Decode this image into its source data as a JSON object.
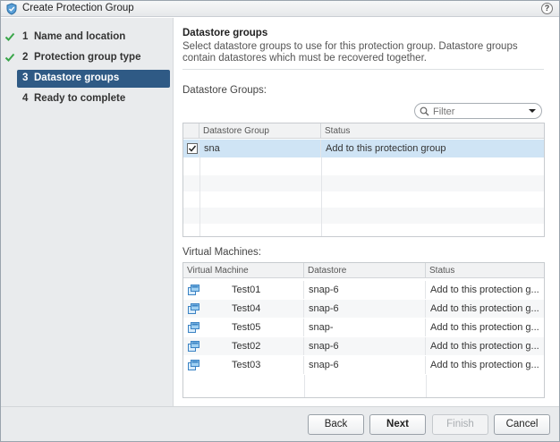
{
  "window": {
    "title": "Create Protection Group",
    "help_label": "?"
  },
  "nav": {
    "items": [
      {
        "number": "1",
        "label": "Name and location",
        "done": true
      },
      {
        "number": "2",
        "label": "Protection group type",
        "done": true
      },
      {
        "number": "3",
        "label": "Datastore groups",
        "active": true
      },
      {
        "number": "4",
        "label": "Ready to complete"
      }
    ]
  },
  "section": {
    "title": "Datastore groups",
    "description": "Select datastore groups to use for this protection group. Datastore groups contain datastores which must be recovered together.",
    "datastore_groups_label": "Datastore Groups:",
    "virtual_machines_label": "Virtual Machines:"
  },
  "filter": {
    "placeholder": "Filter"
  },
  "datastore_grid": {
    "columns": [
      "Datastore Group",
      "Status"
    ],
    "rows": [
      {
        "name": "sna",
        "status": "Add to this protection group",
        "checked": true
      }
    ]
  },
  "vm_grid": {
    "columns": [
      "Virtual Machine",
      "Datastore",
      "Status"
    ],
    "rows": [
      {
        "vm": "Test01",
        "datastore": "snap-6",
        "status": "Add to this protection g..."
      },
      {
        "vm": "Test04",
        "datastore": "snap-6",
        "status": "Add to this protection g..."
      },
      {
        "vm": "Test05",
        "datastore": "snap-",
        "status": "Add to this protection g..."
      },
      {
        "vm": "Test02",
        "datastore": "snap-6",
        "status": "Add to this protection g..."
      },
      {
        "vm": "Test03",
        "datastore": "snap-6",
        "status": "Add to this protection g..."
      }
    ]
  },
  "footer": {
    "back": "Back",
    "next": "Next",
    "finish": "Finish",
    "cancel": "Cancel"
  },
  "colors": {
    "nav_active": "#2f5a85",
    "selected_row": "#cfe4f5",
    "check": "#3aa64a"
  },
  "icons": {
    "app": "shield-icon",
    "done": "check-icon",
    "vm": "vm-icon",
    "filter": "search-icon"
  }
}
